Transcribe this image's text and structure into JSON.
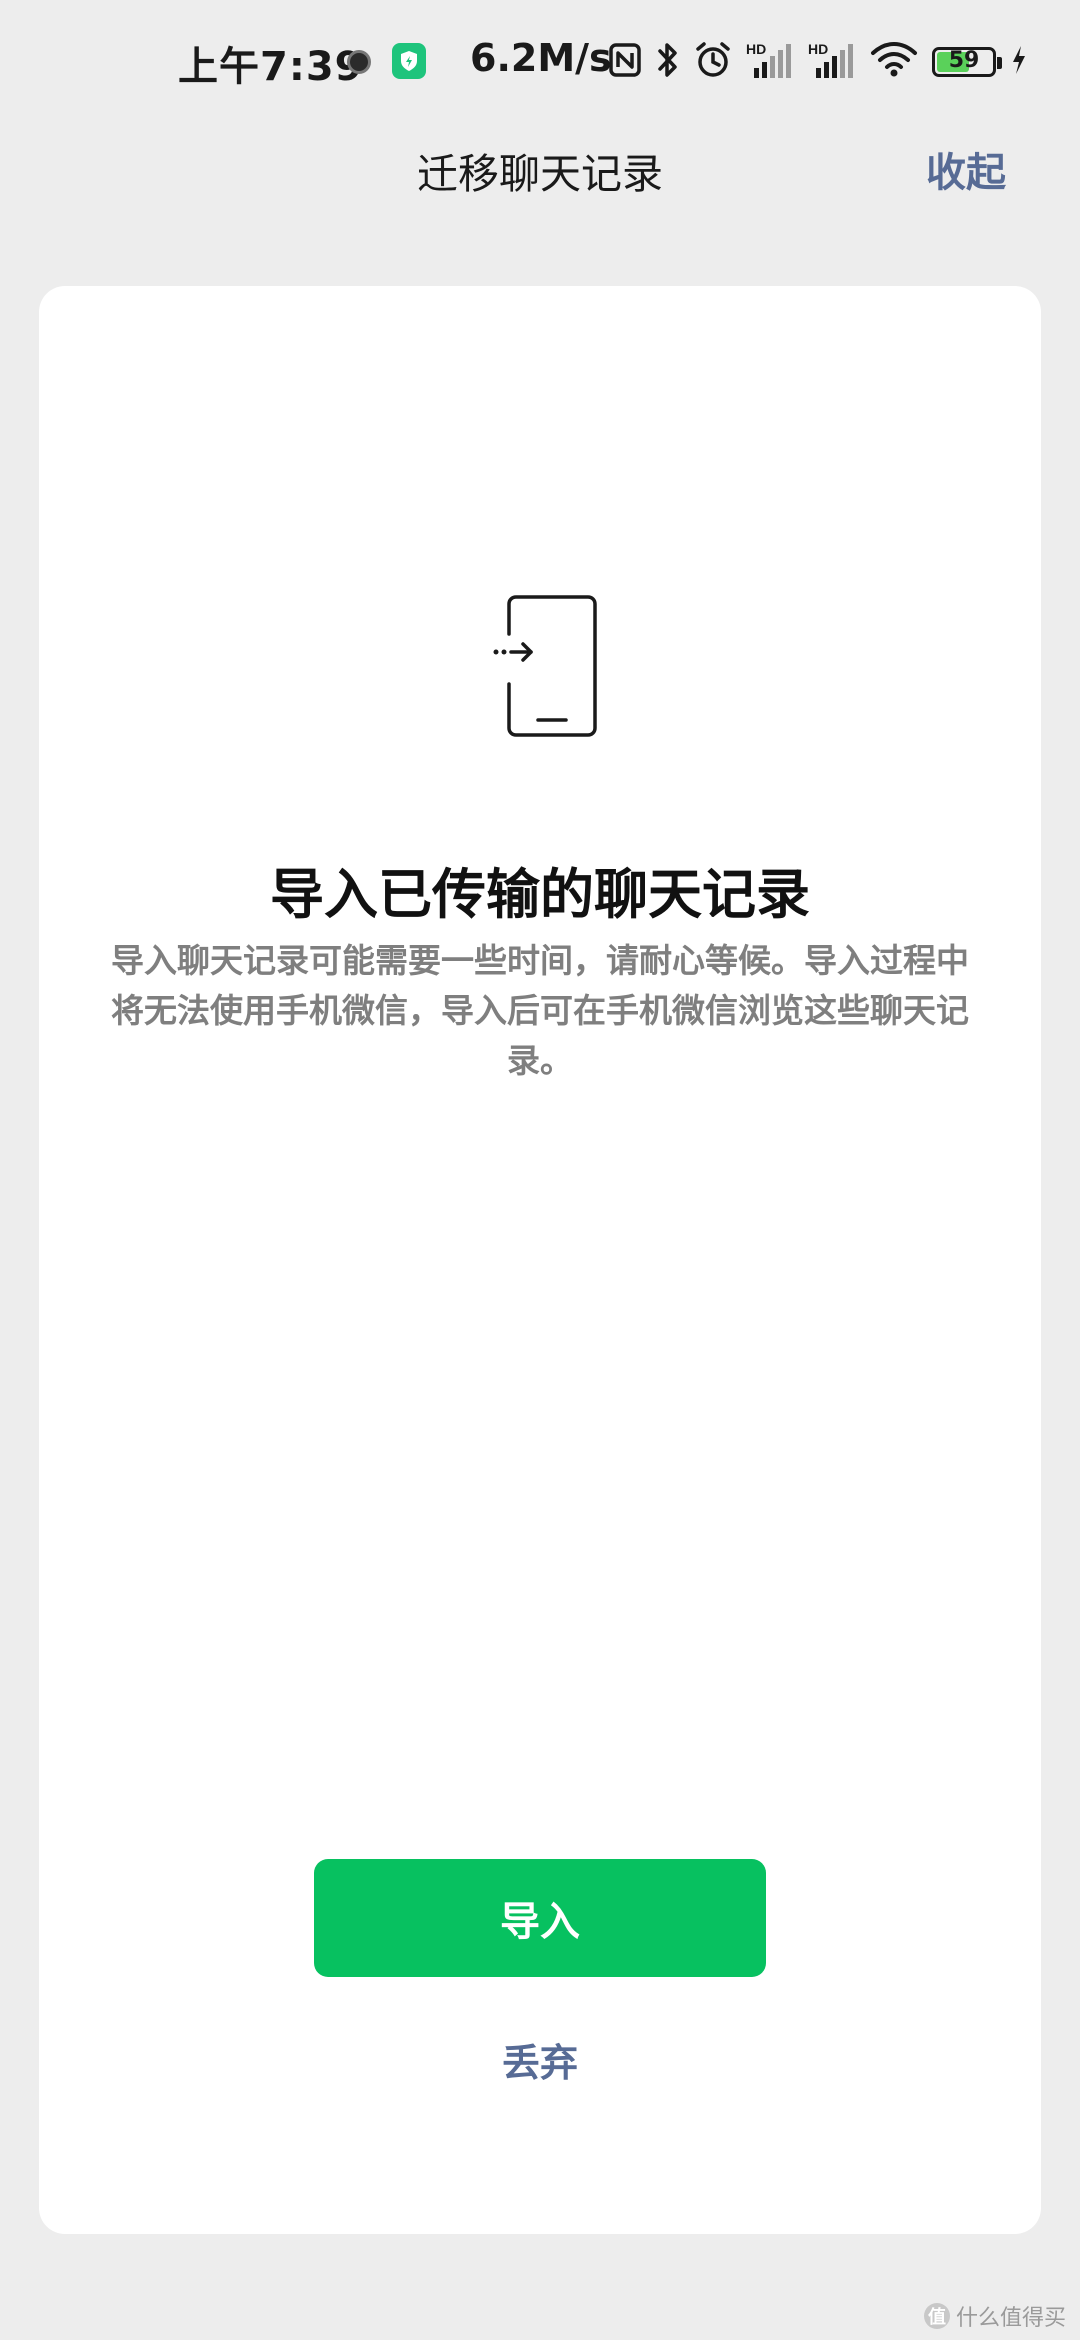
{
  "status_bar": {
    "time": "上午7:39",
    "net_speed": "6.2M/s",
    "battery_level": "59",
    "battery_fraction": 0.59,
    "icons": [
      "recording-dot-icon",
      "shield-app-icon",
      "nfc-icon",
      "bluetooth-icon",
      "alarm-icon",
      "hd-signal-icon",
      "hd-signal-icon",
      "wifi-icon",
      "battery-icon",
      "charging-icon"
    ],
    "hd_label": "HD"
  },
  "header": {
    "title": "迁移聊天记录",
    "collapse_label": "收起"
  },
  "content": {
    "icon": "phone-transfer-icon",
    "title": "导入已传输的聊天记录",
    "description": "导入聊天记录可能需要一些时间，请耐心等候。导入过程中将无法使用手机微信，导入后可在手机微信浏览这些聊天记录。"
  },
  "actions": {
    "import_label": "导入",
    "discard_label": "丢弃"
  },
  "watermark": {
    "text": "什么值得买",
    "mark": "值"
  },
  "colors": {
    "background": "#ededed",
    "card": "#ffffff",
    "primary_button": "#07c160",
    "link": "#576b95",
    "description_text": "#7f7f7f"
  }
}
